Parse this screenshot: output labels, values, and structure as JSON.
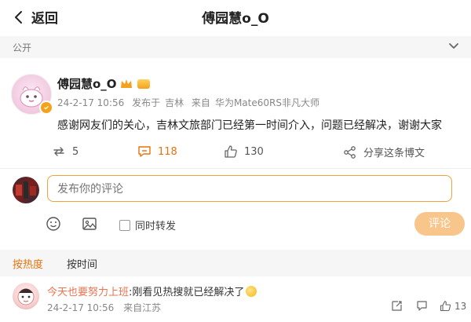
{
  "header": {
    "back_label": "返回",
    "title": "傅园慧o_O"
  },
  "post": {
    "visibility": "公开",
    "author": "傅园慧o_O",
    "time": "24-2-17 10:56",
    "publish_label": "发布于",
    "location": "吉林",
    "source_prefix": "来自",
    "device": "华为Mate60RS非凡大师",
    "text": "感谢网友们的关心，吉林文旅部门已经第一时间介入，问题已经解决，谢谢大家",
    "stats": {
      "reposts": "5",
      "comments": "118",
      "likes": "130"
    },
    "share_label": "分享这条博文"
  },
  "composer": {
    "placeholder": "发布你的评论",
    "repost_label": "同时转发",
    "submit_label": "评论"
  },
  "sort": {
    "active": "按热度",
    "other": "按时间"
  },
  "comments": [
    {
      "user": "今天也要努力上班",
      "text": ":刚看见热搜就已经解决了",
      "time": "24-2-17 10:56",
      "location": "来自江苏",
      "likes": "13"
    }
  ],
  "colors": {
    "accent": "#e8730c",
    "username": "#eb7350",
    "submit_bg": "#f8c58a"
  },
  "icons": [
    "chevron-left-icon",
    "more-icon",
    "repost-icon",
    "comment-icon",
    "like-icon",
    "share-icon",
    "emoji-icon",
    "image-icon",
    "checkbox-icon"
  ]
}
